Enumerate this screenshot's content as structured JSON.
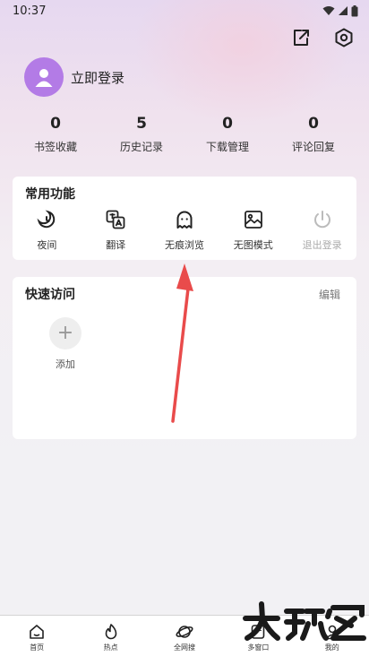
{
  "status": {
    "time": "10:37"
  },
  "header": {
    "share_icon": "share-icon",
    "settings_icon": "settings-icon"
  },
  "profile": {
    "login_label": "立即登录",
    "avatar_icon": "user-icon"
  },
  "stats": [
    {
      "value": "0",
      "label": "书签收藏"
    },
    {
      "value": "5",
      "label": "历史记录"
    },
    {
      "value": "0",
      "label": "下载管理"
    },
    {
      "value": "0",
      "label": "评论回复"
    }
  ],
  "common": {
    "title": "常用功能",
    "items": [
      {
        "label": "夜间",
        "icon": "night-mode-icon"
      },
      {
        "label": "翻译",
        "icon": "translate-icon"
      },
      {
        "label": "无痕浏览",
        "icon": "ghost-icon"
      },
      {
        "label": "无图模式",
        "icon": "no-image-icon"
      },
      {
        "label": "退出登录",
        "icon": "power-icon",
        "disabled": true
      }
    ]
  },
  "quick": {
    "title": "快速访问",
    "edit_label": "编辑",
    "add_label": "添加",
    "add_symbol": "+"
  },
  "tabbar": [
    {
      "label": "首页",
      "icon": "home-icon"
    },
    {
      "label": "热点",
      "icon": "flame-icon"
    },
    {
      "label": "全网搜",
      "icon": "planet-icon"
    },
    {
      "label": "多窗口",
      "icon": "windows-icon",
      "badge": "1"
    },
    {
      "label": "我的",
      "icon": "profile-icon"
    }
  ],
  "watermark": {
    "text": "大玩家"
  },
  "colors": {
    "avatar": "#b37be6",
    "arrow": "#e94b4b",
    "background": "#f2f1f4"
  }
}
